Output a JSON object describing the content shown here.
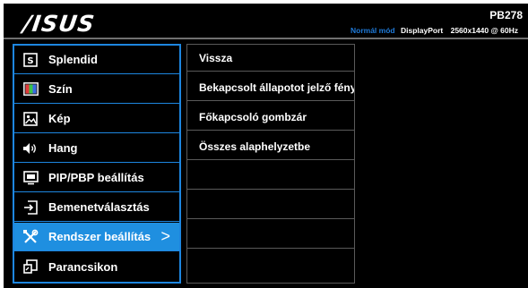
{
  "header": {
    "brand": "/ISUS",
    "model": "PB278",
    "mode_label": "Normál mód",
    "connection": "DisplayPort",
    "resolution": "2560x1440 @ 60Hz"
  },
  "menu": {
    "items": [
      {
        "label": "Splendid",
        "icon": "splendid-s-icon"
      },
      {
        "label": "Szín",
        "icon": "color-icon"
      },
      {
        "label": "Kép",
        "icon": "image-icon"
      },
      {
        "label": "Hang",
        "icon": "speaker-icon"
      },
      {
        "label": "PIP/PBP beállítás",
        "icon": "pip-icon"
      },
      {
        "label": "Bemenetválasztás",
        "icon": "input-icon"
      },
      {
        "label": "Rendszer beállítás",
        "icon": "tools-icon",
        "active": true,
        "arrow": ">"
      },
      {
        "label": "Parancsikon",
        "icon": "shortcut-icon"
      }
    ]
  },
  "submenu": {
    "items": [
      {
        "label": "Vissza"
      },
      {
        "label": "Bekapcsolt állapotot jelző fény"
      },
      {
        "label": "Főkapcsoló gombzár"
      },
      {
        "label": "Összes alaphelyzetbe"
      },
      {
        "label": ""
      },
      {
        "label": ""
      },
      {
        "label": ""
      },
      {
        "label": ""
      }
    ]
  },
  "colors": {
    "accent": "#1f8fe0",
    "border": "#1d86e0",
    "mode_text": "#1f7ad8",
    "background": "#000000"
  }
}
